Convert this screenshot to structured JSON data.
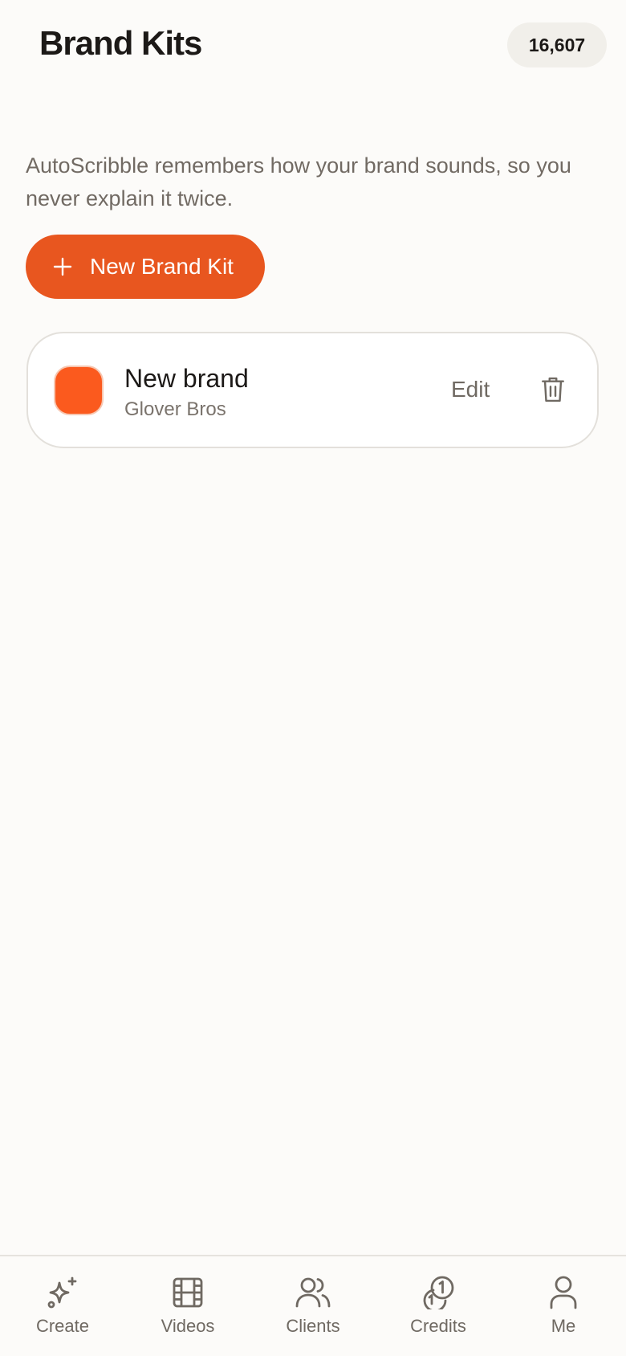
{
  "header": {
    "title": "Brand Kits",
    "credits_balance": "16,607"
  },
  "intro_text": "AutoScribble remembers how your brand sounds, so you never explain it twice.",
  "new_kit_button": {
    "label": "New Brand Kit",
    "icon": "plus-icon"
  },
  "brand_kits": [
    {
      "name": "New brand",
      "client": "Glover Bros",
      "color": "#fb5a1e",
      "edit_label": "Edit",
      "delete_icon": "trash-icon"
    }
  ],
  "bottom_nav": {
    "items": [
      {
        "label": "Create",
        "icon": "sparkle-icon"
      },
      {
        "label": "Videos",
        "icon": "film-icon"
      },
      {
        "label": "Clients",
        "icon": "users-icon"
      },
      {
        "label": "Credits",
        "icon": "coins-icon"
      },
      {
        "label": "Me",
        "icon": "person-icon"
      }
    ]
  },
  "colors": {
    "accent": "#e8561f",
    "background": "#fcfbf9",
    "text_primary": "#1c1917",
    "text_secondary": "#716a63"
  }
}
